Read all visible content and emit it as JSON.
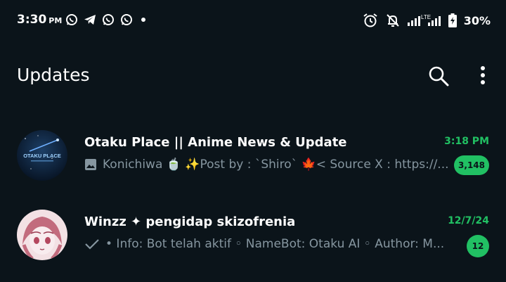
{
  "status_bar": {
    "time": "3:30",
    "ampm": "PM",
    "notification_icons": [
      "whatsapp-icon",
      "telegram-icon",
      "whatsapp-icon",
      "whatsapp-icon",
      "dot-icon"
    ],
    "right_icons": [
      "alarm-icon",
      "mute-bell-icon",
      "signal-lte-icon",
      "battery-charging-icon"
    ],
    "lte_label": "LTE",
    "battery": "30%"
  },
  "header": {
    "title": "Updates",
    "search_icon": "search-icon",
    "more_icon": "more-vertical-icon"
  },
  "chats": [
    {
      "name": "Otaku Place || Anime News & Update",
      "time": "3:18 PM",
      "preview": "Konichiwa 🍵 ✨Post by : `Shiro` 🍁< Source X : https://...",
      "preview_icon": "image-icon",
      "avatar_text": "OTAKU PLACE",
      "unread": "3,148"
    },
    {
      "name": "Winzz ✦ pengidap skizofrenia",
      "time": "12/7/24",
      "preview": "• Info: Bot telah aktif ◦ NameBot: Otaku AI ◦ Author: M...",
      "preview_icon": "check-icon",
      "unread": "12"
    }
  ],
  "colors": {
    "background": "#0b141a",
    "accent_green": "#21c063",
    "secondary_text": "#8696a0"
  }
}
